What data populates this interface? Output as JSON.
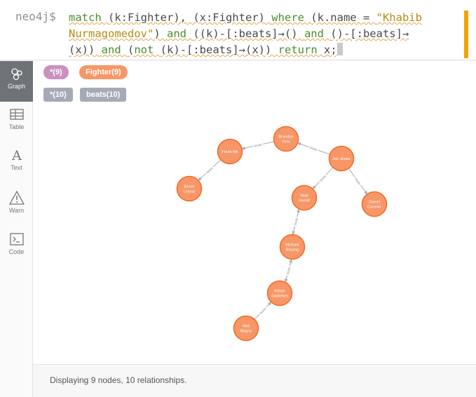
{
  "query": {
    "prompt": "neo4j$",
    "line1": [
      {
        "t": "match ",
        "c": "kw"
      },
      {
        "t": "(k:Fighter), (x:Fighter) ",
        "c": "var"
      },
      {
        "t": "where ",
        "c": "kw"
      },
      {
        "t": "(k.name = ",
        "c": "var"
      },
      {
        "t": "\"Khabib",
        "c": "str"
      }
    ],
    "line2": [
      {
        "t": "Nurmagomedov\"",
        "c": "str"
      },
      {
        "t": ") ",
        "c": "var"
      },
      {
        "t": "and ",
        "c": "kw"
      },
      {
        "t": "((k)-[:beats]→() ",
        "c": "var"
      },
      {
        "t": "and ",
        "c": "kw"
      },
      {
        "t": "()-[:beats]→",
        "c": "var"
      }
    ],
    "line3": [
      {
        "t": "(x)) ",
        "c": "var"
      },
      {
        "t": "and ",
        "c": "kw"
      },
      {
        "t": "(",
        "c": "var"
      },
      {
        "t": "not ",
        "c": "kw"
      },
      {
        "t": "(k)-[:beats]→(x)) ",
        "c": "var"
      },
      {
        "t": "return ",
        "c": "kw"
      },
      {
        "t": "x;",
        "c": "var"
      }
    ],
    "accent_color": "#f1a400"
  },
  "sidebar": {
    "items": [
      {
        "label": "Graph",
        "icon": "graph-icon",
        "active": true
      },
      {
        "label": "Table",
        "icon": "table-icon",
        "active": false
      },
      {
        "label": "Text",
        "icon": "text-icon",
        "active": false
      },
      {
        "label": "Warn",
        "icon": "warning-icon",
        "active": false
      },
      {
        "label": "Code",
        "icon": "code-icon",
        "active": false
      }
    ]
  },
  "legend": {
    "node_labels": [
      {
        "text": "*(9)",
        "color": "#c990c0"
      },
      {
        "text": "Fighter(9)",
        "color": "#f79767"
      }
    ],
    "rel_types": [
      {
        "text": "*(10)",
        "color": "#a5abb6"
      },
      {
        "text": "beats(10)",
        "color": "#a5abb6"
      }
    ]
  },
  "graph": {
    "node_color": "#f79767",
    "node_border": "#f36924",
    "rel_label": "beats",
    "nodes": [
      {
        "id": "brandon",
        "lines": [
          "Brandon",
          "Vera"
        ]
      },
      {
        "id": "frank",
        "lines": [
          "Frank Mir"
        ]
      },
      {
        "id": "jon",
        "lines": [
          "Jon Jones"
        ]
      },
      {
        "id": "brock",
        "lines": [
          "Brock",
          "Lesnar"
        ]
      },
      {
        "id": "matt",
        "lines": [
          "Matt",
          "Hamill"
        ]
      },
      {
        "id": "daniel",
        "lines": [
          "Daniel",
          "Cormier"
        ]
      },
      {
        "id": "michael",
        "lines": [
          "Michael",
          "Bisping"
        ]
      },
      {
        "id": "kelvin",
        "lines": [
          "Kelvin",
          "Gastelum"
        ]
      },
      {
        "id": "neil",
        "lines": [
          "Neil",
          "Magny"
        ]
      }
    ],
    "relationships": [
      {
        "from": "brandon",
        "to": "frank"
      },
      {
        "from": "jon",
        "to": "brandon"
      },
      {
        "from": "frank",
        "to": "brock"
      },
      {
        "from": "jon",
        "to": "matt"
      },
      {
        "from": "jon",
        "to": "daniel"
      },
      {
        "from": "matt",
        "to": "michael"
      },
      {
        "from": "michael",
        "to": "matt"
      },
      {
        "from": "michael",
        "to": "kelvin"
      },
      {
        "from": "kelvin",
        "to": "michael"
      },
      {
        "from": "neil",
        "to": "kelvin"
      }
    ]
  },
  "status": {
    "text": "Displaying 9 nodes, 10 relationships."
  }
}
